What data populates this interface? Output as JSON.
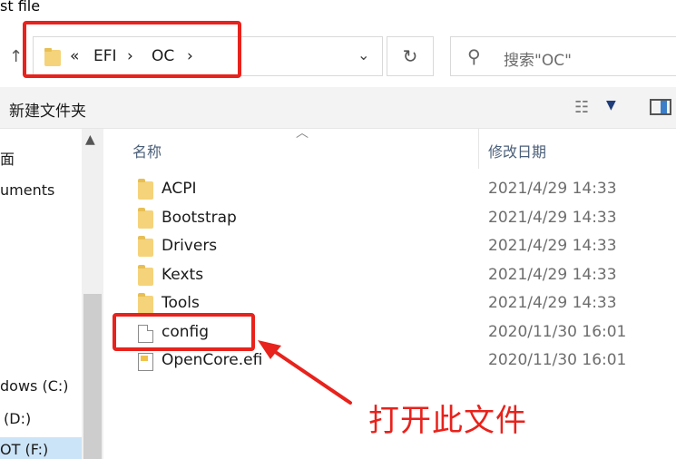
{
  "window": {
    "title_fragment": "st file"
  },
  "address_bar": {
    "overflow": "«",
    "crumbs": [
      "EFI",
      "OC"
    ],
    "separator": "›"
  },
  "search": {
    "placeholder": "搜索\"OC\""
  },
  "toolbar": {
    "new_folder": "新建文件夹"
  },
  "nav_pane": {
    "items": [
      {
        "label": "面"
      },
      {
        "label": "uments"
      },
      {
        "label": "dows (C:)"
      },
      {
        "label": "(D:)"
      },
      {
        "label": "OT (F:)"
      }
    ]
  },
  "columns": {
    "name": "名称",
    "date_modified": "修改日期"
  },
  "files": [
    {
      "name": "ACPI",
      "date": "2021/4/29 14:33",
      "type": "folder"
    },
    {
      "name": "Bootstrap",
      "date": "2021/4/29 14:33",
      "type": "folder"
    },
    {
      "name": "Drivers",
      "date": "2021/4/29 14:33",
      "type": "folder"
    },
    {
      "name": "Kexts",
      "date": "2021/4/29 14:33",
      "type": "folder"
    },
    {
      "name": "Tools",
      "date": "2021/4/29 14:33",
      "type": "folder"
    },
    {
      "name": "config",
      "date": "2020/11/30 16:01",
      "type": "file"
    },
    {
      "name": "OpenCore.efi",
      "date": "2020/11/30 16:01",
      "type": "efi"
    }
  ],
  "annotation": {
    "text": "打开此文件",
    "color": "#e8221c"
  },
  "icons": {
    "up": "up-arrow-icon",
    "refresh": "refresh-icon",
    "search": "search-icon",
    "view": "details-view-icon",
    "preview": "preview-pane-icon"
  }
}
